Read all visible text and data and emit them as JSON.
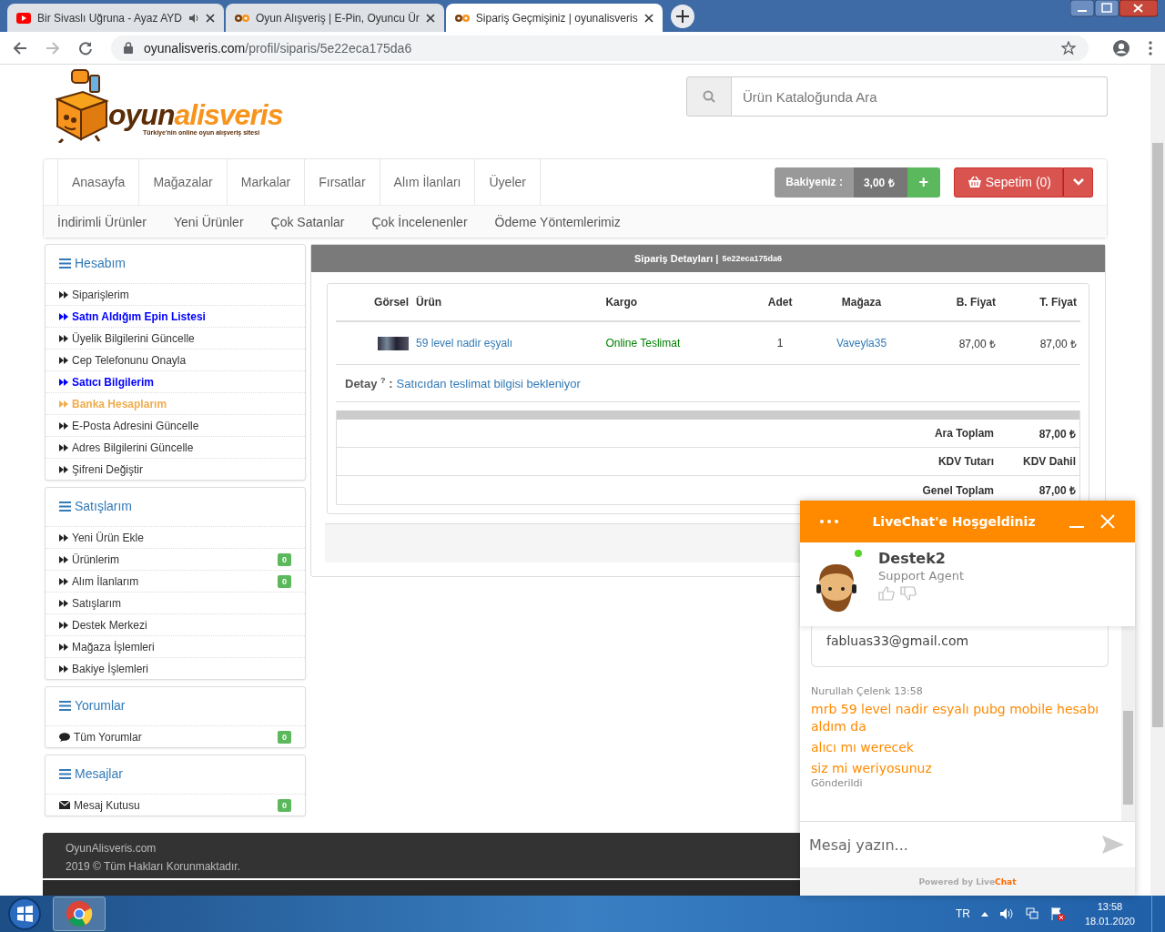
{
  "browser": {
    "tabs": [
      {
        "title": "Bir Sivaslı Uğruna - Ayaz AYD",
        "audio": true,
        "selected": false
      },
      {
        "title": "Oyun Alışveriş | E-Pin, Oyuncu Ür",
        "audio": false,
        "selected": false
      },
      {
        "title": "Sipariş Geçmişiniz | oyunalisveris",
        "audio": false,
        "selected": true
      }
    ],
    "url": {
      "domain": "oyunalisveris.com",
      "path": "/profil/siparis/5e22eca175da6"
    }
  },
  "header": {
    "logo": {
      "part1": "oyun",
      "part2": "alisveris",
      "tagline": "Türkiye'nin online oyun alışveriş sitesi"
    },
    "search": {
      "placeholder": "Ürün Kataloğunda Ara"
    }
  },
  "nav": {
    "primary": [
      "Anasayfa",
      "Mağazalar",
      "Markalar",
      "Fırsatlar",
      "Alım İlanları",
      "Üyeler"
    ],
    "balance": {
      "label": "Bakiyeniz :",
      "amount": "3,00 ₺",
      "add": "+"
    },
    "cart": "Sepetim (0)",
    "secondary": [
      "İndirimli Ürünler",
      "Yeni Ürünler",
      "Çok Satanlar",
      "Çok İncelenenler",
      "Ödeme Yöntemlerimiz"
    ]
  },
  "sidebar": {
    "panels": [
      {
        "title": "Hesabım",
        "items": [
          {
            "label": "Siparişlerim",
            "kind": "link",
            "color": "#333333",
            "bold": false
          },
          {
            "label": "Satın Aldığım Epin Listesi",
            "kind": "link",
            "color": "#0000ff",
            "bold": true
          },
          {
            "label": "Üyelik Bilgilerini Güncelle",
            "kind": "link",
            "color": "#333333",
            "bold": false
          },
          {
            "label": "Cep Telefonunu Onayla",
            "kind": "link",
            "color": "#333333",
            "bold": false
          },
          {
            "label": "Satıcı Bilgilerim",
            "kind": "link",
            "color": "#0000ff",
            "bold": true
          },
          {
            "label": "Banka Hesaplarım",
            "kind": "link",
            "color": "#f0ad4e",
            "bold": true
          },
          {
            "label": "E-Posta Adresini Güncelle",
            "kind": "link",
            "color": "#333333",
            "bold": false
          },
          {
            "label": "Adres Bilgilerini Güncelle",
            "kind": "link",
            "color": "#333333",
            "bold": false
          },
          {
            "label": "Şifreni Değiştir",
            "kind": "link",
            "color": "#333333",
            "bold": false
          }
        ]
      },
      {
        "title": "Satışlarım",
        "items": [
          {
            "label": "Yeni Ürün Ekle",
            "kind": "link",
            "color": "#333333",
            "bold": false
          },
          {
            "label": "Ürünlerim",
            "kind": "link",
            "color": "#333333",
            "bold": false,
            "badge": "0"
          },
          {
            "label": "Alım İlanlarım",
            "kind": "link",
            "color": "#333333",
            "bold": false,
            "badge": "0"
          },
          {
            "label": "Satışlarım",
            "kind": "link",
            "color": "#333333",
            "bold": false
          },
          {
            "label": "Destek Merkezi",
            "kind": "link",
            "color": "#333333",
            "bold": false
          },
          {
            "label": "Mağaza İşlemleri",
            "kind": "link",
            "color": "#333333",
            "bold": false
          },
          {
            "label": "Bakiye İşlemleri",
            "kind": "link",
            "color": "#333333",
            "bold": false
          }
        ]
      },
      {
        "title": "Yorumlar",
        "items": [
          {
            "label": "Tüm Yorumlar",
            "kind": "comment",
            "color": "#333333",
            "bold": false,
            "badge": "0"
          }
        ]
      },
      {
        "title": "Mesajlar",
        "items": [
          {
            "label": "Mesaj Kutusu",
            "kind": "message",
            "color": "#333333",
            "bold": false,
            "badge": "0"
          }
        ]
      }
    ]
  },
  "order": {
    "title": "Sipariş Detayları |",
    "order_id": "5e22eca175da6",
    "columns": [
      "Görsel",
      "Ürün",
      "Kargo",
      "Adet",
      "Mağaza",
      "B. Fiyat",
      "T. Fiyat"
    ],
    "rows": [
      {
        "product": "59 level nadir eşyalı",
        "shipping": "Online Teslimat",
        "qty": "1",
        "store": "Vaveyla35",
        "unit_price": "87,00 ₺",
        "total_price": "87,00 ₺"
      }
    ],
    "detail": {
      "label": "Detay",
      "mark": "?",
      "separator": ":",
      "value": "Satıcıdan teslimat bilgisi bekleniyor"
    },
    "totals": [
      {
        "label": "Ara Toplam",
        "value": "87,00 ₺"
      },
      {
        "label": "KDV Tutarı",
        "value": "KDV Dahil"
      },
      {
        "label": "Genel Toplam",
        "value": "87,00 ₺"
      }
    ]
  },
  "footer": {
    "site": "OyunAlisveris.com",
    "copyright": "2019 © Tüm Hakları Korunmaktadır."
  },
  "livechat": {
    "title": "LiveChat'e Hoşgeldiniz",
    "agent": {
      "name": "Destek2",
      "role": "Support Agent",
      "online": true
    },
    "email": "fabluas33@gmail.com",
    "message_author": "Nurullah Çelenk 13:58",
    "messages": [
      "mrb 59 level nadir esyalı pubg mobile hesabı aldım da",
      "alıcı mı werecek",
      "siz mi weriyosunuz"
    ],
    "status": "Gönderildi",
    "input": {
      "placeholder": "Mesaj yazın..."
    },
    "powered": {
      "prefix": "Powered by Live",
      "brand": "Chat"
    }
  },
  "taskbar": {
    "language": "TR",
    "time": "13:58",
    "date": "18.01.2020"
  }
}
